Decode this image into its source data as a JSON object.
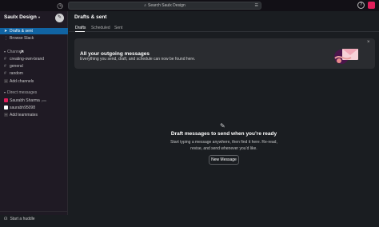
{
  "topbar": {
    "search_placeholder": "Search Saulx Design",
    "history_icon": "clock-icon",
    "help_icon": "help-icon"
  },
  "sidebar": {
    "workspace": "Saulx Design",
    "items": [
      {
        "label": "Drafts & sent",
        "icon": "send-icon",
        "active": true
      },
      {
        "label": "Browse Slack",
        "icon": "dots-icon",
        "active": false
      }
    ],
    "channels_header": "Channels",
    "channels": [
      "creating-own-brand",
      "general",
      "random"
    ],
    "add_channels": "Add channels",
    "dm_header": "Direct messages",
    "dms": [
      {
        "name": "Saurabh Sharma",
        "tag": "you",
        "color": "#e01e5a"
      },
      {
        "name": "saurabh95098",
        "tag": "",
        "color": "#ffffff"
      }
    ],
    "add_teammates": "Add teammates",
    "huddle": "Start a huddle"
  },
  "main": {
    "title": "Drafts & sent",
    "tabs": [
      "Drafts",
      "Scheduled",
      "Sent"
    ],
    "banner": {
      "title": "All your outgoing messages",
      "subtitle": "Everything you send, draft, and schedule can now be found here."
    },
    "empty": {
      "title": "Draft messages to send when you’re ready",
      "body": "Start typing a message anywhere, then find it here. Re-read, revise, and send whenever you’d like.",
      "button": "New Message"
    }
  },
  "colors": {
    "active": "#1164a3",
    "sidebar_bg": "#1f1a24",
    "main_bg": "#1a1d21",
    "accent_red": "#e01e5a"
  }
}
